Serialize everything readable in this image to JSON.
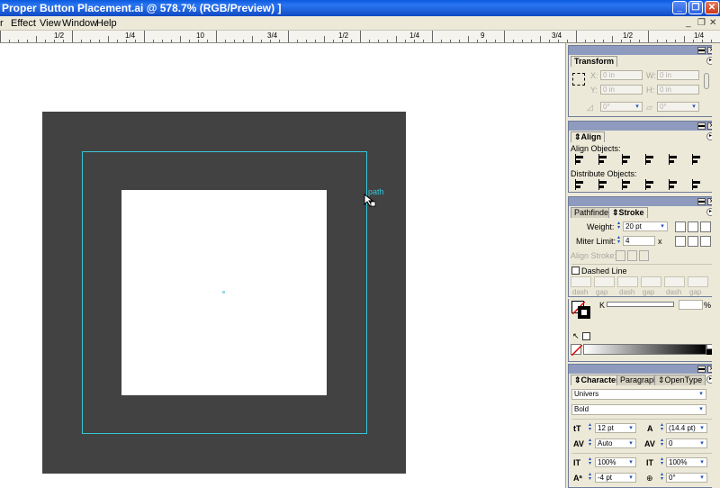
{
  "window": {
    "title": "Proper Button Placement.ai @ 578.7% (RGB/Preview) ]",
    "minimize": "_",
    "restore": "❐",
    "close": "✕"
  },
  "menubar": {
    "items": [
      "r",
      "Effect",
      "View",
      "Window",
      "Help"
    ],
    "doc_controls": [
      "_",
      "❐",
      "✕"
    ]
  },
  "ruler": {
    "labels": [
      "1/2",
      "1/4",
      "10",
      "3/4",
      "1/2",
      "1/4",
      "9",
      "3/4",
      "1/2",
      "1/4"
    ]
  },
  "canvas": {
    "path_label": "path"
  },
  "transform": {
    "title": "Transform",
    "x_label": "X:",
    "x_value": "0 in",
    "y_label": "Y:",
    "y_value": "0 in",
    "w_label": "W:",
    "w_value": "0 in",
    "h_label": "H:",
    "h_value": "0 in",
    "rotate_value": "0°",
    "shear_value": "0°"
  },
  "align": {
    "title": "Align",
    "align_objects": "Align Objects:",
    "distribute_objects": "Distribute Objects:"
  },
  "stroke": {
    "tab_pathfinder": "Pathfinder",
    "tab_stroke": "Stroke",
    "weight_label": "Weight:",
    "weight_value": "20 pt",
    "miter_label": "Miter Limit:",
    "miter_value": "4",
    "miter_unit": "x",
    "align_label": "Align Stroke:",
    "dashed_label": "Dashed Line",
    "dash_labels": [
      "dash",
      "gap",
      "dash",
      "gap",
      "dash",
      "gap"
    ]
  },
  "color": {
    "k_label": "K",
    "percent": "%"
  },
  "character": {
    "tab_character": "Character",
    "tab_paragraph": "Paragraph",
    "tab_opentype": "OpenType",
    "font": "Univers",
    "style": "Bold",
    "size": "12 pt",
    "leading": "(14.4 pt)",
    "kerning": "Auto",
    "tracking": "0",
    "vscale": "100%",
    "hscale": "100%",
    "baseline": "-4 pt",
    "rotation": "0°"
  }
}
